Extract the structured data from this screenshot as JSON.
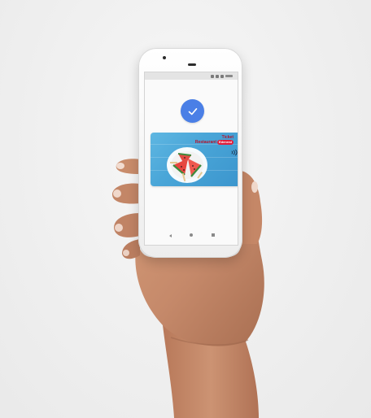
{
  "scene": {
    "background_color": "#efefef",
    "skin_color": "#c98c6b"
  },
  "phone": {
    "body_color": "#ffffff"
  },
  "screen": {
    "status_icons": [
      "signal-icon",
      "wifi-icon",
      "battery-icon"
    ],
    "confirmation": {
      "icon": "check-icon",
      "color": "#4a7fe6"
    },
    "card": {
      "brand_line_1": "Ticket",
      "brand_line_2": "Restaurant",
      "brand_badge": "Edenred",
      "contactless_icon": "nfc-icon",
      "background_color": "#4aa6d8",
      "artwork": "watermelon-slices-plate"
    },
    "nav_buttons": [
      "back-button",
      "home-button",
      "recents-button"
    ]
  }
}
